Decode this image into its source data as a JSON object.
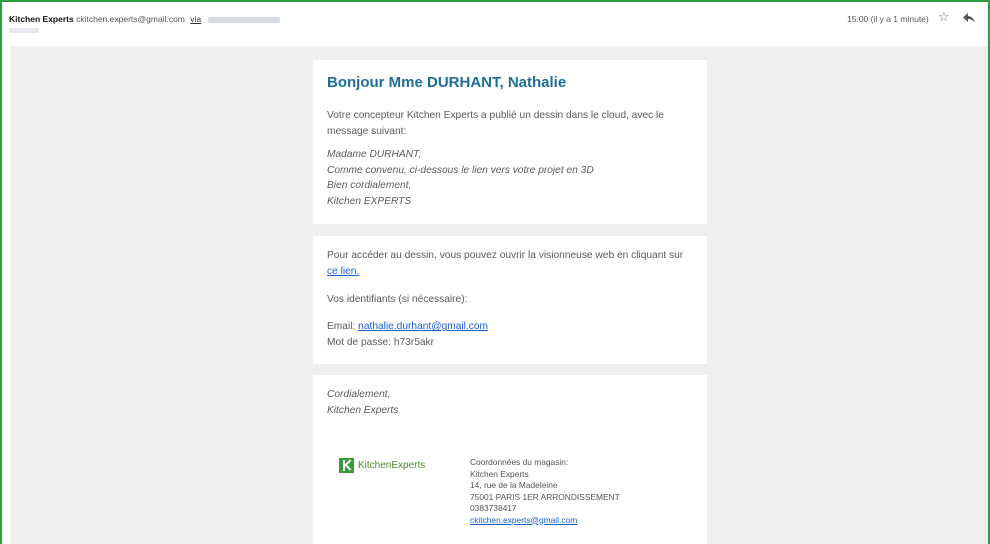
{
  "header": {
    "sender_name": "Kitchen Experts",
    "sender_email": "ckitchen.experts@gmail.com",
    "via_label": "via",
    "time_text": "15:00 (il y a 1 minute)",
    "star_icon": "star-icon",
    "reply_icon": "reply-arrow-icon"
  },
  "message": {
    "greeting": "Bonjour Mme DURHANT, Nathalie",
    "intro_line1": "Votre concepteur Kitchen Experts a publié un dessin dans le cloud, avec le",
    "intro_line2": "message suivant:",
    "quote": [
      "Madame DURHANT,",
      "Comme convenu, ci-dessous le lien vers votre projet en 3D",
      "Bien cordialement,",
      "Kitchen EXPERTS"
    ],
    "access_line": "Pour accéder au dessin, vous pouvez ouvrir la visionneuse web en cliquant sur",
    "access_link": "ce lien.",
    "credentials_label": "Vos identifiants (si nécessaire):",
    "email_label": "Email:",
    "email_value": "nathalie.durhant@gmail.com",
    "password_line": "Mot de passe: h73r5akr",
    "closing_line1": "Cordialement,",
    "closing_line2": "Kitchen Experts"
  },
  "footer": {
    "logo_text": "KitchenExperts",
    "store_title": "Coordonnées du magasin:",
    "store_name": "Kitchen Experts",
    "store_address": "14, rue de la Madeleine",
    "store_city": "75001 PARIS 1ER ARRONDISSEMENT",
    "store_phone": "0383738417",
    "store_email": "ckitchen.experts@gmail.com"
  },
  "colors": {
    "accent": "#1f6e97",
    "link": "#1a5fd1",
    "frame": "#2e9e3e",
    "background": "#efefef",
    "brand_green": "#3c9a3a"
  }
}
